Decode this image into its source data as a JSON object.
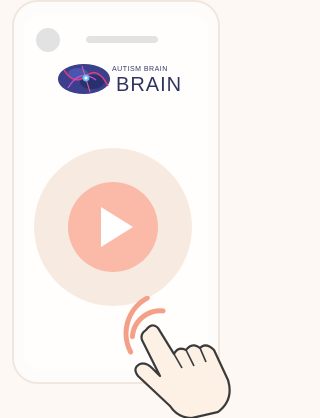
{
  "logo": {
    "tagline": "AUTISM BRAIN",
    "name": "BRAIN"
  },
  "icons": {
    "camera": "camera-dot-icon",
    "speaker": "speaker-icon",
    "brain": "brain-logo-icon",
    "play": "play-icon",
    "tap": "tap-hand-icon"
  },
  "colors": {
    "background": "#fdf8f4",
    "phone_border": "#f2e6dc",
    "play_halo": "#f7ebe1",
    "play_button": "#fbb9a8",
    "tap_ring": "#f4a088",
    "logo_text": "#2f3563"
  }
}
